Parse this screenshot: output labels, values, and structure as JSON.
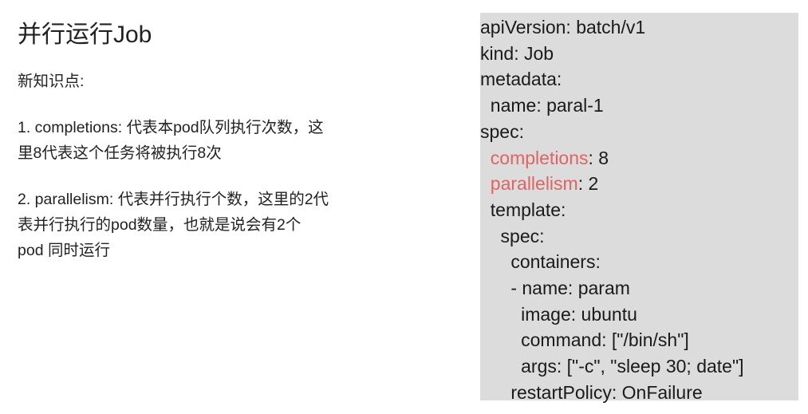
{
  "left": {
    "title": "并行运行Job",
    "subtitle": "新知识点:",
    "point1": {
      "line1": "1. completions:  代表本pod队列执行次数，这",
      "line2": "里8代表这个任务将被执行8次"
    },
    "point2": {
      "line1": "2. parallelism:  代表并行执行个数，这里的2代",
      "line2": "表并行执行的pod数量，也就是说会有2个",
      "line3": "pod 同时运行"
    }
  },
  "code": {
    "lines": [
      "apiVersion: batch/v1",
      "kind: Job",
      "metadata:",
      "  name: paral-1",
      "spec:",
      "  completions",
      "  parallelism",
      "  template:",
      "    spec:",
      "      containers:",
      "      - name: param",
      "        image: ubuntu",
      "        command: [\"/bin/sh\"]",
      "        args: [\"-c\", \"sleep 30; date\"]",
      "      restartPolicy: OnFailure"
    ],
    "completions_value": ": 8",
    "parallelism_value": ": 2",
    "highlight_color": "#e0645f",
    "background_color": "#dcdcdc"
  }
}
